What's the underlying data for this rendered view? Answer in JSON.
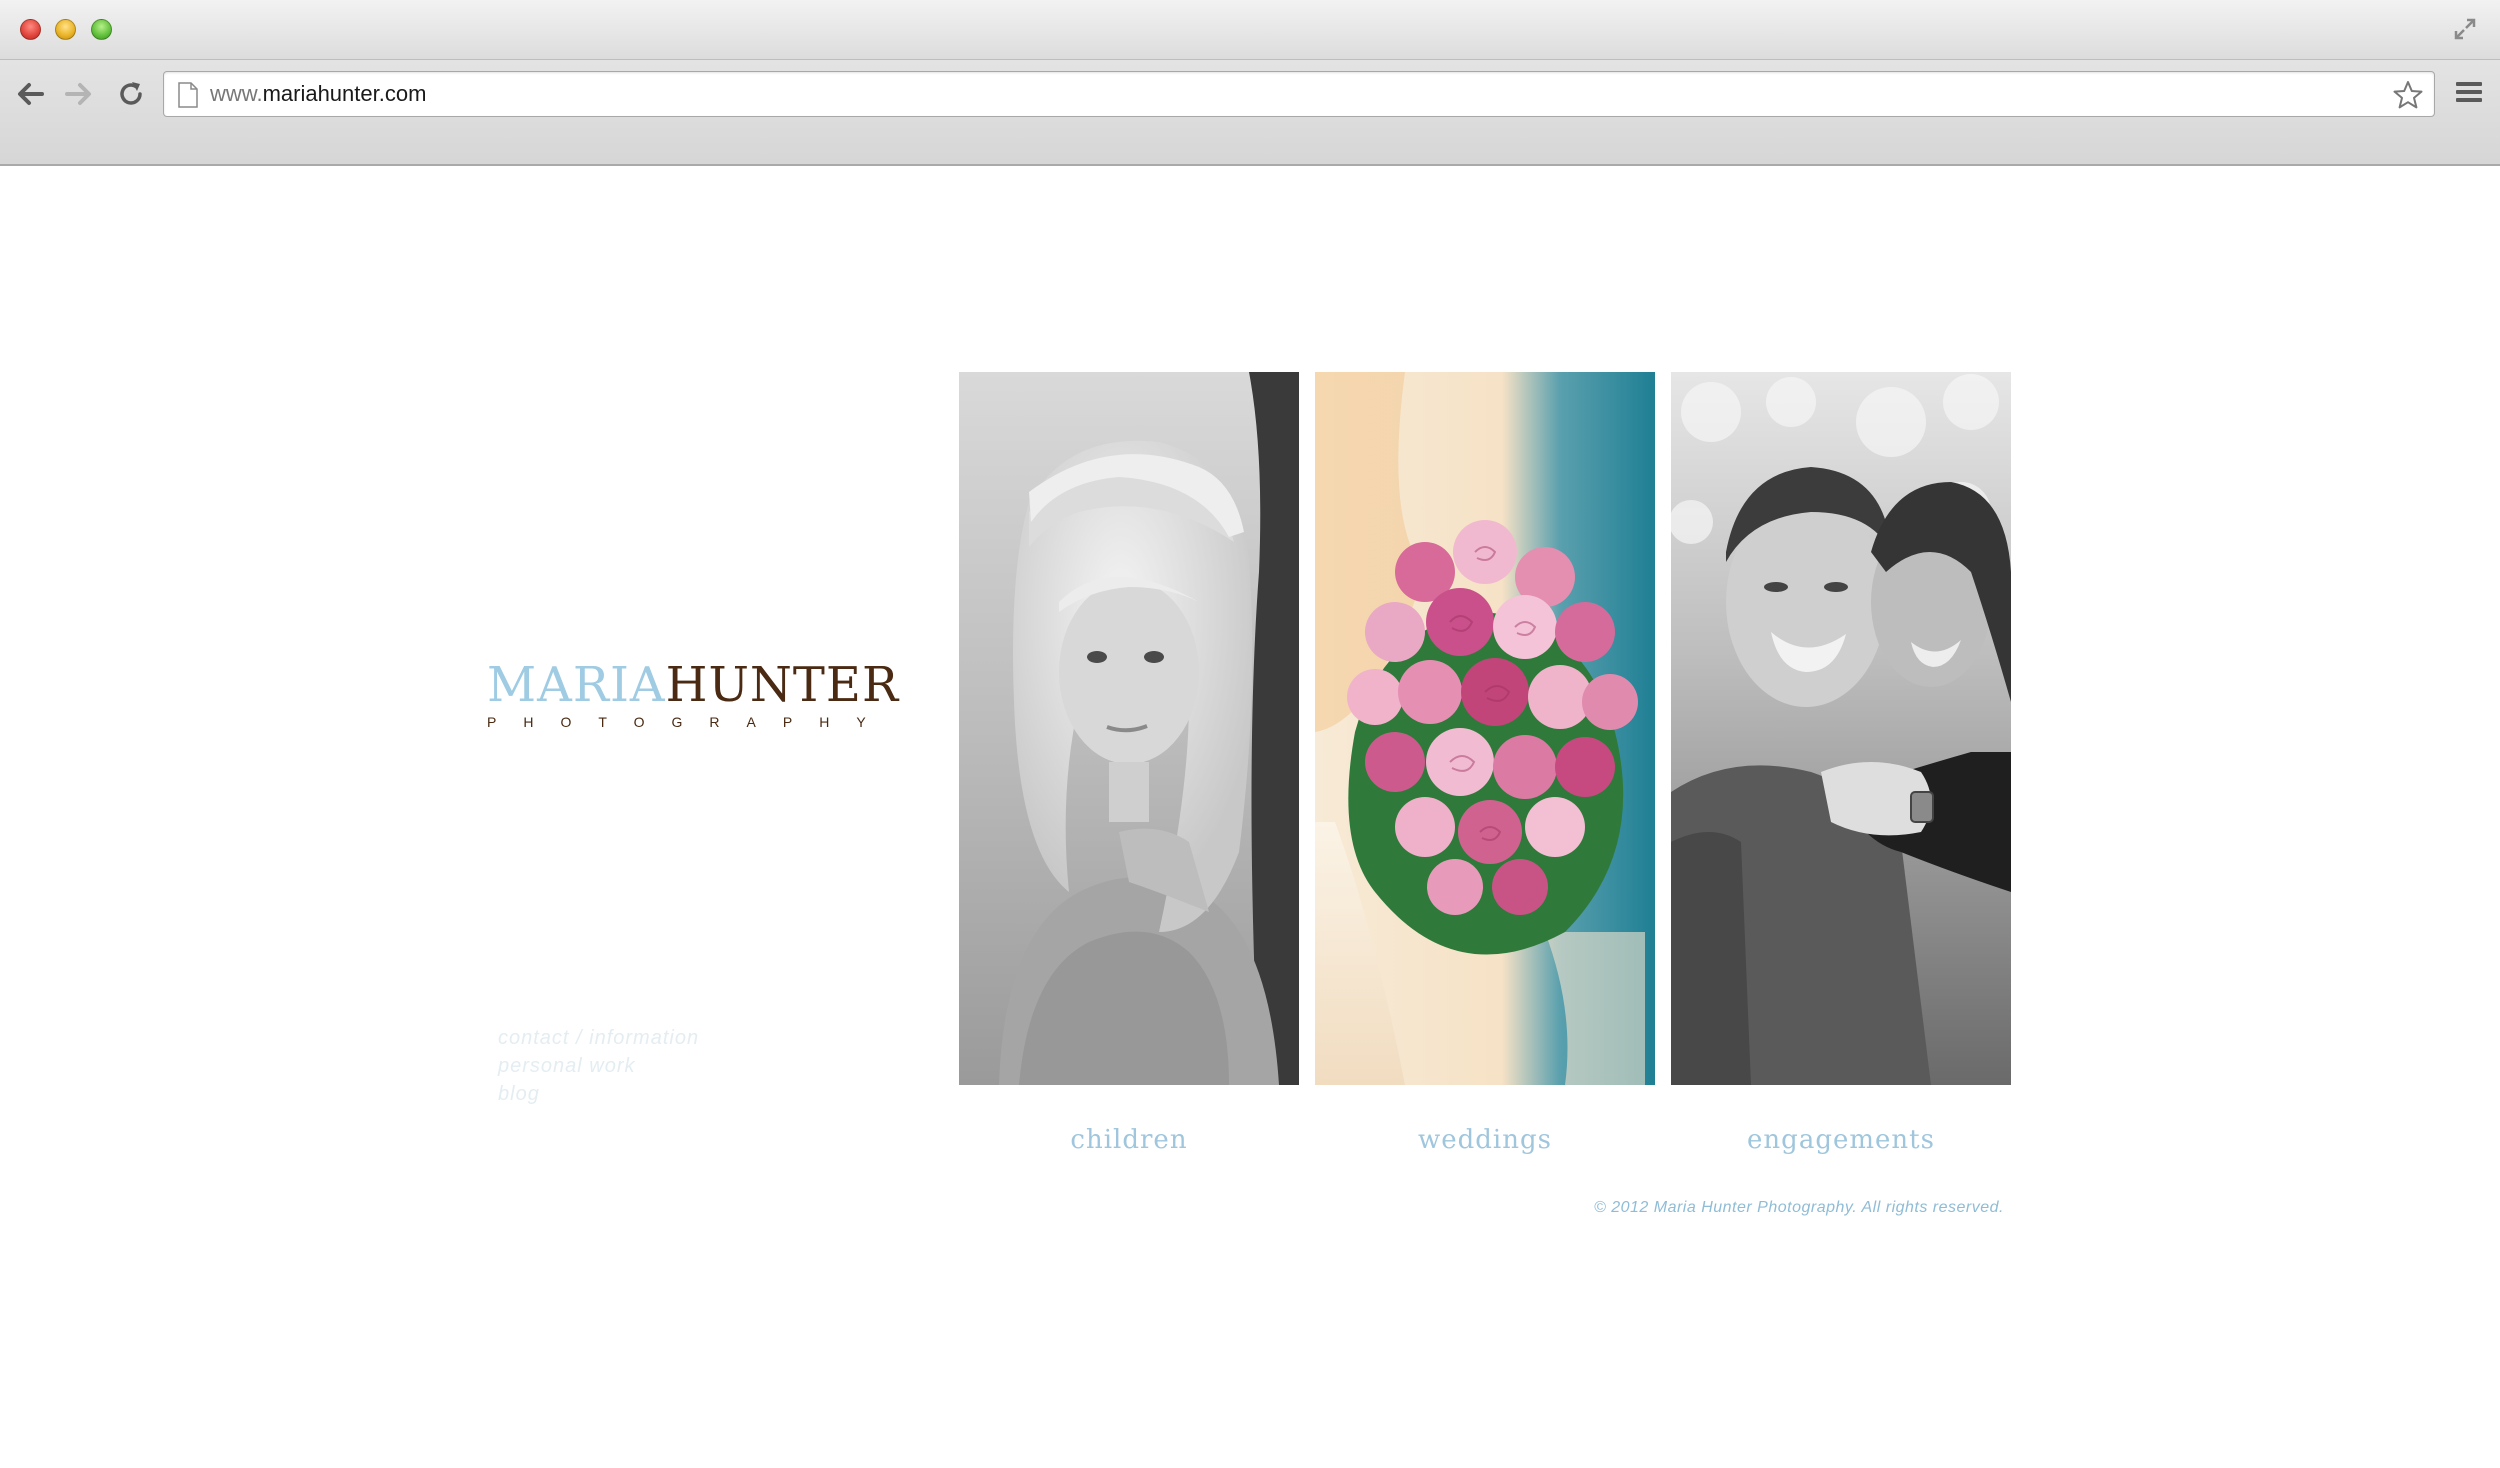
{
  "browser": {
    "url_prefix": "www.",
    "url_host": "mariahunter.com"
  },
  "logo": {
    "first_name": "MARIA",
    "last_name": "HUNTER",
    "subtitle": "PHOTOGRAPHY"
  },
  "side_nav": {
    "items": [
      {
        "label": "contact / information"
      },
      {
        "label": "personal work"
      },
      {
        "label": "blog"
      }
    ]
  },
  "galleries": [
    {
      "label": "children"
    },
    {
      "label": "weddings"
    },
    {
      "label": "engagements"
    }
  ],
  "footer": {
    "copyright": "© 2012 Maria Hunter Photography. All rights reserved."
  },
  "colors": {
    "brand_light_blue": "#9fcbe3",
    "brand_brown": "#4a2a12",
    "category_label": "#9fc6dd"
  }
}
